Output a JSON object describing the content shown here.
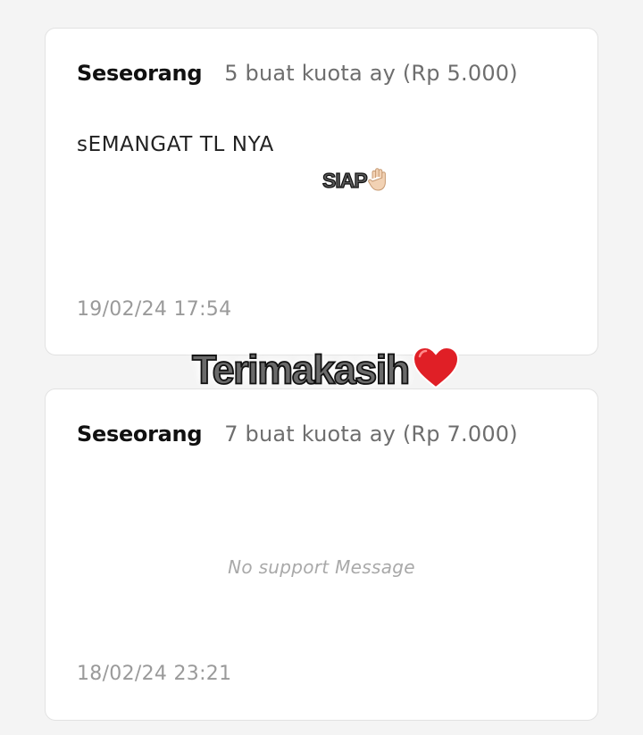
{
  "cards": [
    {
      "supporter": "Seseorang",
      "description": "5 buat kuota ay (Rp 5.000)",
      "message": "sEMANGAT TL NYA",
      "timestamp": "19/02/24 17:54"
    },
    {
      "supporter": "Seseorang",
      "description": "7 buat kuota ay (Rp 7.000)",
      "empty_message": "No support Message",
      "timestamp": "18/02/24 23:21"
    }
  ],
  "stickers": {
    "siap": "SIAP",
    "siap_icon": "raised-hand-icon",
    "thanks": "Terimakasih",
    "thanks_icon": "red-heart-icon"
  },
  "colors": {
    "background": "#f4f4f4",
    "card": "#ffffff",
    "heart": "#e01f26"
  }
}
